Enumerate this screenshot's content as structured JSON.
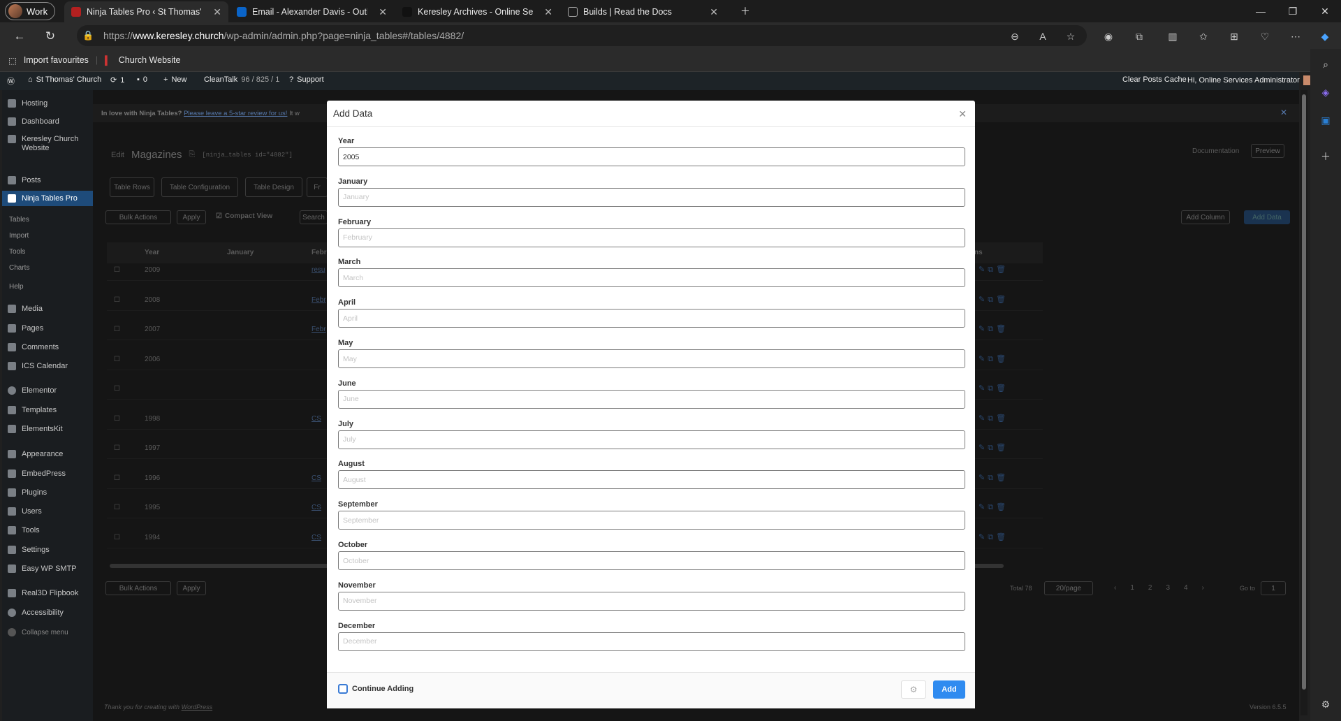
{
  "browser": {
    "profile": "Work",
    "tabs": [
      {
        "title": "Ninja Tables Pro ‹ St Thomas' Ch",
        "active": true
      },
      {
        "title": "Email - Alexander Davis - Outlo"
      },
      {
        "title": "Keresley Archives - Online Servic"
      },
      {
        "title": "Builds | Read the Docs"
      }
    ],
    "url_prefix": "https://",
    "url_host": "www.keresley.church",
    "url_path": "/wp-admin/admin.php?page=ninja_tables#/tables/4882/",
    "favourites": [
      "Import favourites",
      "Church Website"
    ]
  },
  "wp_admin_bar": {
    "site": "St Thomas' Church",
    "updates": "1",
    "comments": "0",
    "new": "New",
    "cleantalk_label": "CleanTalk",
    "cleantalk_stats": "96 / 825 / 1",
    "support": "Support",
    "clear_cache": "Clear Posts Cache",
    "greeting": "Hi, Online Services Administrator"
  },
  "menu": {
    "items": [
      "Hosting",
      "Dashboard",
      "Keresley Church Website",
      "Posts",
      "Ninja Tables Pro",
      "Media",
      "Pages",
      "Comments",
      "ICS Calendar",
      "Elementor",
      "Templates",
      "ElementsKit",
      "Appearance",
      "EmbedPress",
      "Plugins",
      "Users",
      "Tools",
      "Settings",
      "Easy WP SMTP",
      "Real3D Flipbook",
      "Accessibility",
      "Collapse menu"
    ],
    "submenu": [
      "Tables",
      "Import",
      "Tools",
      "Charts",
      "Help"
    ]
  },
  "page": {
    "notice": "In love with Ninja Tables?",
    "notice_link": "Please leave a 5-star review for us!",
    "notice_tail": "It w",
    "edit": "Edit",
    "title": "Magazines",
    "shortcode": "[ninja_tables id=\"4882\"]",
    "documentation": "Documentation",
    "preview": "Preview",
    "tabs": [
      "Table Rows",
      "Table Configuration",
      "Table Design",
      "Fr"
    ],
    "bulk_actions": "Bulk Actions",
    "apply": "Apply",
    "compact_view": "Compact View",
    "search": "Search",
    "add_column": "Add Column",
    "add_data": "Add Data",
    "columns": [
      "Year",
      "January",
      "Febr",
      "ns"
    ],
    "rows": [
      "2009",
      "2008",
      "2007",
      "2006",
      "",
      "1998",
      "1997",
      "1996",
      "1995",
      "1994"
    ],
    "feb_cells": [
      "resu",
      "Febr",
      "Febr",
      "",
      "",
      "CS",
      "",
      "CS",
      "CS",
      "CS"
    ],
    "total": "Total 78",
    "per_page": "20/page",
    "pages": [
      "1",
      "2",
      "3",
      "4"
    ],
    "goto": "Go to",
    "goto_value": "1",
    "footer_thanks": "Thank you for creating with",
    "footer_link": "WordPress",
    "version": "Version 6.5.5"
  },
  "modal": {
    "title": "Add Data",
    "fields": [
      {
        "label": "Year",
        "value": "2005",
        "placeholder": ""
      },
      {
        "label": "January",
        "value": "",
        "placeholder": "January"
      },
      {
        "label": "February",
        "value": "",
        "placeholder": "February"
      },
      {
        "label": "March",
        "value": "",
        "placeholder": "March"
      },
      {
        "label": "April",
        "value": "",
        "placeholder": "April"
      },
      {
        "label": "May",
        "value": "",
        "placeholder": "May"
      },
      {
        "label": "June",
        "value": "",
        "placeholder": "June"
      },
      {
        "label": "July",
        "value": "",
        "placeholder": "July"
      },
      {
        "label": "August",
        "value": "",
        "placeholder": "August"
      },
      {
        "label": "September",
        "value": "",
        "placeholder": "September"
      },
      {
        "label": "October",
        "value": "",
        "placeholder": "October"
      },
      {
        "label": "November",
        "value": "",
        "placeholder": "November"
      },
      {
        "label": "December",
        "value": "",
        "placeholder": "December"
      }
    ],
    "continue_adding": "Continue Adding",
    "add_button": "Add"
  }
}
